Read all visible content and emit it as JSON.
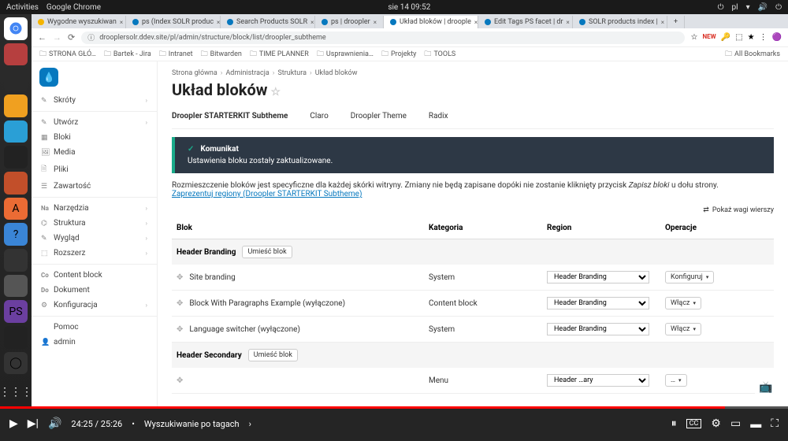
{
  "topbar": {
    "left": [
      "Activities",
      "Google Chrome"
    ],
    "center": "sie 14  09:52",
    "right": [
      "pl"
    ]
  },
  "tabs": [
    {
      "label": "Wygodne wyszukiwan",
      "fav": "#f4b400"
    },
    {
      "label": "ps (Index SOLR produc",
      "fav": "#0678be"
    },
    {
      "label": "Search Products SOLR",
      "fav": "#0678be"
    },
    {
      "label": "ps | droopler",
      "fav": "#0678be"
    },
    {
      "label": "Układ bloków | droople",
      "fav": "#0678be",
      "active": true
    },
    {
      "label": "Edit Tags PS facet | dr",
      "fav": "#0678be"
    },
    {
      "label": "SOLR products index |",
      "fav": "#0678be"
    }
  ],
  "url": "drooplersolr.ddev.site/pl/admin/structure/block/list/droopler_subtheme",
  "bookmarks": [
    "STRONA GŁÓ…",
    "Bartek - Jira",
    "Intranet",
    "Bitwarden",
    "TIME PLANNER",
    "Usprawnienia…",
    "Projekty",
    "TOOLS"
  ],
  "allbookmarks": "All Bookmarks",
  "sidebar": {
    "items": [
      {
        "label": "Skróty",
        "ico": "✎",
        "chev": true
      },
      {
        "label": "Utwórz",
        "ico": "✎",
        "chev": true
      },
      {
        "label": "Bloki",
        "ico": "▦"
      },
      {
        "label": "Media",
        "ico": "🖼"
      },
      {
        "label": "Pliki",
        "ico": "🗎"
      },
      {
        "label": "Zawartość",
        "ico": "☰"
      },
      {
        "label": "Narzędzia",
        "prefix": "Na",
        "chev": true
      },
      {
        "label": "Struktura",
        "ico": "⌬",
        "chev": true
      },
      {
        "label": "Wygląd",
        "ico": "✎",
        "chev": true
      },
      {
        "label": "Rozszerz",
        "ico": "⬚",
        "chev": true
      },
      {
        "label": "Content block",
        "prefix": "Co"
      },
      {
        "label": "Dokument",
        "prefix": "Do"
      },
      {
        "label": "Konfiguracja",
        "ico": "⚙",
        "chev": true
      },
      {
        "label": "Pomoc"
      },
      {
        "label": "admin",
        "ico": "👤"
      }
    ]
  },
  "crumbs": [
    "Strona główna",
    "Administracja",
    "Struktura",
    "Układ bloków"
  ],
  "title": "Układ bloków",
  "themetabs": [
    "Droopler STARTERKIT Subtheme",
    "Claro",
    "Droopler Theme",
    "Radix"
  ],
  "message": {
    "title": "Komunikat",
    "body": "Ustawienia bloku zostały zaktualizowane."
  },
  "desc": {
    "text": "Rozmieszczenie bloków jest specyficzne dla każdej skórki witryny. Zmiany nie będą zapisane dopóki nie zostanie kliknięty przycisk ",
    "em": "Zapisz bloki",
    "after": " u dołu strony.",
    "link": "Zaprezentuj regiony (Droopler STARTERKIT Subtheme)"
  },
  "showrows": "Pokaż wagi wierszy",
  "table": {
    "headers": {
      "blok": "Blok",
      "kat": "Kategoria",
      "reg": "Region",
      "op": "Operacje"
    },
    "place_btn": "Umieść blok",
    "regions": [
      {
        "name": "Header Branding",
        "blocks": [
          {
            "name": "Site branding",
            "cat": "System",
            "region": "Header Branding",
            "op": "Konfiguruj"
          },
          {
            "name": "Block With Paragraphs Example (wyłączone)",
            "cat": "Content block",
            "region": "Header Branding",
            "op": "Włącz"
          },
          {
            "name": "Language switcher (wyłączone)",
            "cat": "System",
            "region": "Header Branding",
            "op": "Włącz"
          }
        ]
      },
      {
        "name": "Header Secondary",
        "blocks": [
          {
            "name": "",
            "cat": "Menu",
            "region": "Header …ary",
            "op": "…"
          }
        ]
      }
    ]
  },
  "yt": {
    "time": "24:25 / 25:26",
    "title": "Wyszukiwanie po tagach"
  }
}
